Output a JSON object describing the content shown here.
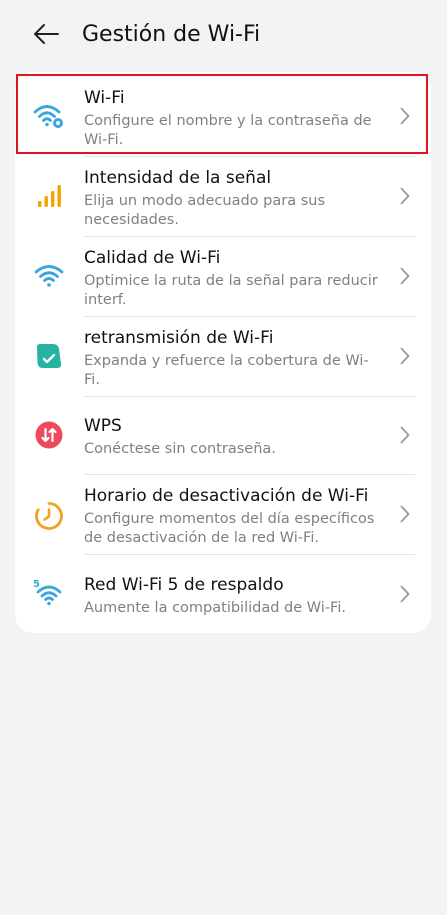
{
  "header": {
    "title": "Gestión de Wi-Fi",
    "back_icon": "arrow-left-icon"
  },
  "items": [
    {
      "title": "Wi-Fi",
      "subtitle": "Configure el nombre y la contraseña de Wi-Fi.",
      "icon": "wifi-settings-icon",
      "highlighted": true
    },
    {
      "title": "Intensidad de la señal",
      "subtitle": "Elija un modo adecuado para sus necesidades.",
      "icon": "signal-bars-icon"
    },
    {
      "title": "Calidad de Wi-Fi",
      "subtitle": "Optimice la ruta de la señal para reducir interf.",
      "icon": "wifi-quality-icon"
    },
    {
      "title": "retransmisión de Wi-Fi",
      "subtitle": "Expanda y refuerce la cobertura de Wi-Fi.",
      "icon": "repeater-icon"
    },
    {
      "title": "WPS",
      "subtitle": "Conéctese sin contraseña.",
      "icon": "wps-icon"
    },
    {
      "title": "Horario de desactivación de Wi-Fi",
      "subtitle": "Configure momentos del día específicos de desactivación de la red Wi-Fi.",
      "icon": "timer-icon"
    },
    {
      "title": "Red Wi-Fi 5 de respaldo",
      "subtitle": "Aumente la compatibilidad de Wi-Fi.",
      "icon": "wifi-5-icon",
      "badge": "5"
    }
  ],
  "colors": {
    "background": "#f1f3f5",
    "card": "#ffffff",
    "wifi_blue": "#3aa6dc",
    "signal_orange": "#f0a400",
    "repeater_teal": "#27b3a1",
    "wps_red": "#ec4a5e",
    "timer_orange": "#f1a224",
    "highlight_red": "#e0161f",
    "subtitle_gray": "#808080"
  }
}
